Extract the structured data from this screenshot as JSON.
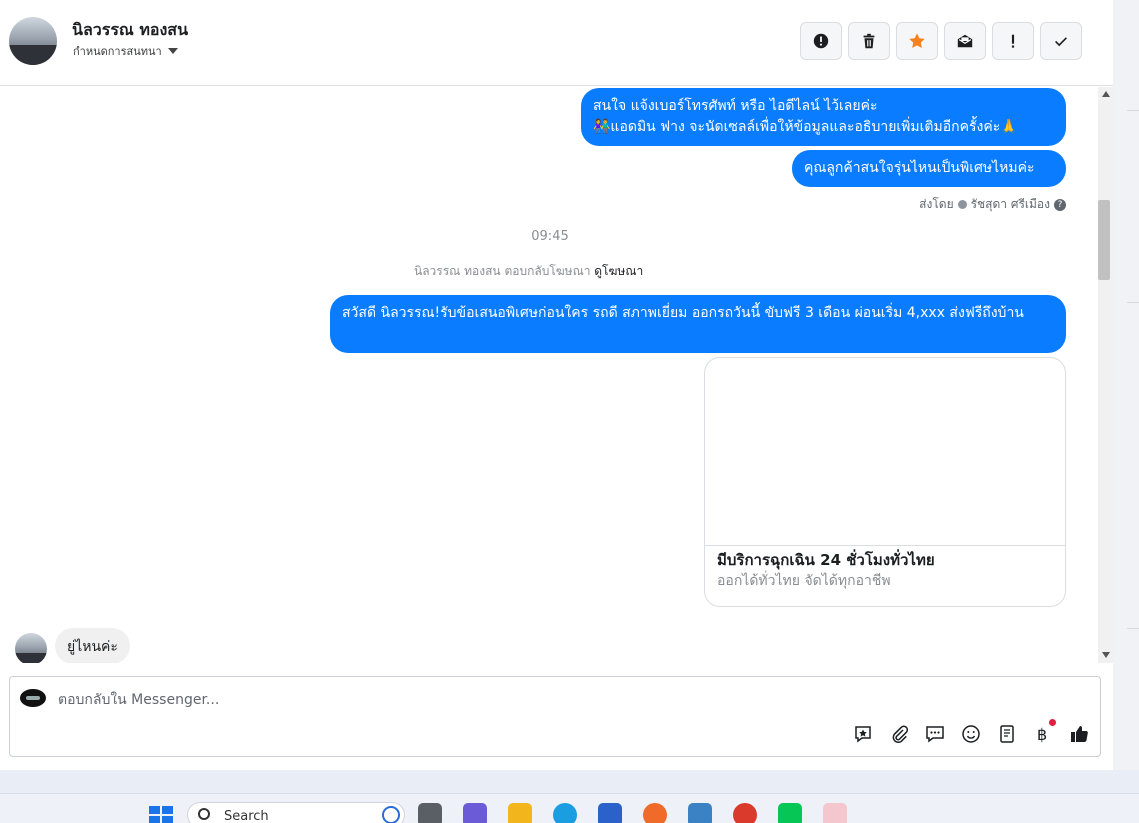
{
  "header": {
    "contact_name": "นิลวรรณ ทองสน",
    "assign_label": "กำหนดการสนทนา"
  },
  "toolbar": {
    "buttons": [
      {
        "name": "spam-icon"
      },
      {
        "name": "trash-icon"
      },
      {
        "name": "star-icon",
        "color": "#f5821f"
      },
      {
        "name": "mark-unread-icon"
      },
      {
        "name": "priority-icon"
      },
      {
        "name": "done-check-icon"
      }
    ]
  },
  "messages": {
    "bubble1_line1": "สนใจ แจ้งเบอร์โทรศัพท์ หรือ ไอดีไลน์  ไว้เลยค่ะ",
    "bubble1_line2": "👫แอดมิน ฟาง จะนัดเซลล์เพื่อให้ข้อมูลและอธิบายเพิ่มเติมอีกครั้งค่ะ🙏",
    "bubble2": "คุณลูกค้าสนใจรุ่นไหนเป็นพิเศษไหมค่ะ",
    "sent_by_label": "ส่งโดย",
    "sent_by_name": "รัชสุดา ศรีเมือง",
    "time": "09:45",
    "reply_note": "นิลวรรณ ทองสน ตอบกลับโฆษณา",
    "view_ad_link": "ดูโฆษณา",
    "bubble3": "สวัสดี นิลวรรณ!รับข้อเสนอพิเศษก่อนใคร รถดี สภาพเยี่ยม ออกรถวันนี้ ขับฟรี 3 เดือน ผ่อนเริ่ม 4,xxx ส่งฟรีถึงบ้าน",
    "ad_card": {
      "title": "มีบริการฉุกเฉิน 24 ชั่วโมงทั่วไทย",
      "subtitle": "ออกได้ทั่วไทย จัดได้ทุกอาชีพ"
    },
    "incoming": "ยู่ไหนค่ะ"
  },
  "composer": {
    "placeholder": "ตอบกลับใน Messenger...",
    "tools": [
      "saved-reply-icon",
      "attachment-icon",
      "chat-bubble-icon",
      "emoji-icon",
      "catalog-icon",
      "payment-baht-icon",
      "like-thumb-icon"
    ]
  },
  "taskbar": {
    "search_label": "Search"
  },
  "colors": {
    "outgoing_bubble": "#0a7cff",
    "accent_star": "#f5821f"
  }
}
